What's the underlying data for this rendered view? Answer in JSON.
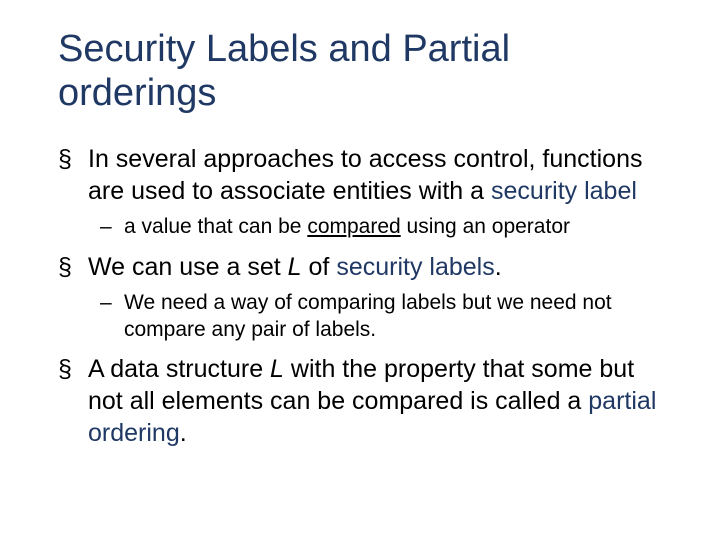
{
  "title": "Security Labels and Partial orderings",
  "b1_pre": "In several approaches to access control, functions are used to associate entities with a ",
  "b1_hl": "security label",
  "b1_sub_pre": "a value that can be ",
  "b1_sub_ul": "compared",
  "b1_sub_post": " using an operator",
  "b2_pre": "We can use a set ",
  "b2_it": "L",
  "b2_mid": " of ",
  "b2_hl": "security labels",
  "b2_post": ".",
  "b2_sub": "We need a way of comparing labels but we need not compare any pair of labels.",
  "b3_pre": "A data structure ",
  "b3_it": "L",
  "b3_mid": " with the property that some but not all elements can be compared is called a ",
  "b3_hl": "partial ordering",
  "b3_post": "."
}
